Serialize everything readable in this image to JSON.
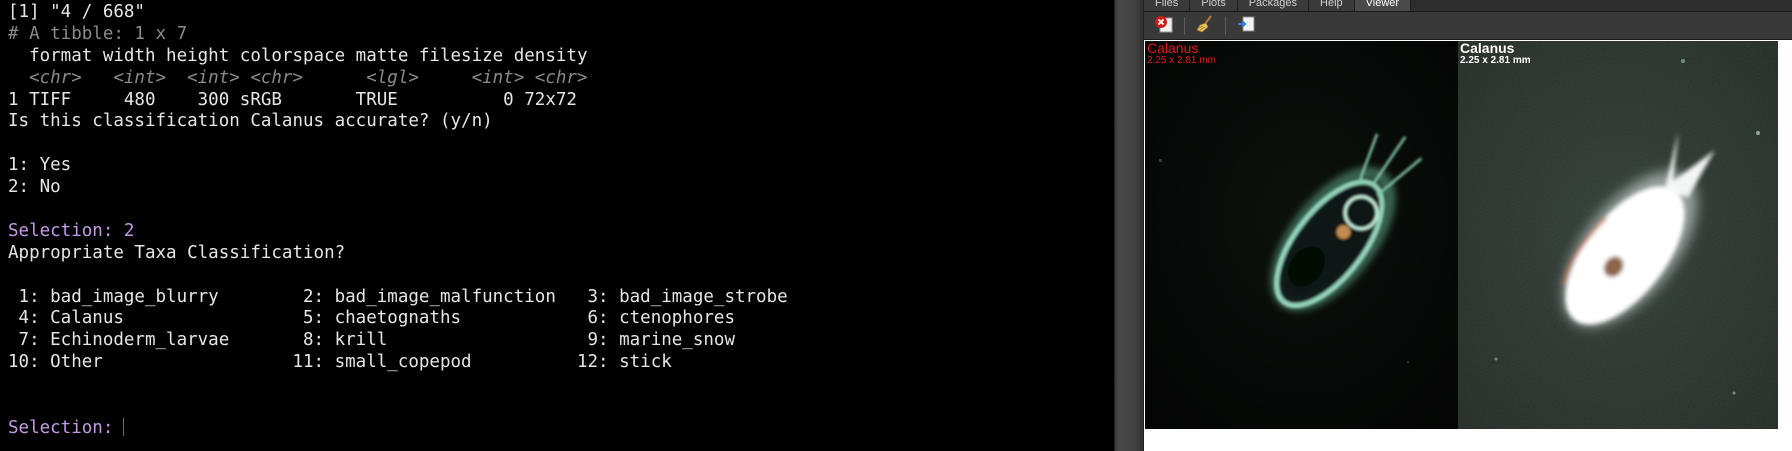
{
  "console": {
    "output_line": "[1] \"4 / 668\"",
    "tibble_header": "# A tibble: 1 x 7",
    "columns_header": "  format width height colorspace matte filesize density",
    "types_row": "  <chr>   <int>  <int> <chr>      <lgl>     <int> <chr>",
    "data_row": "1 TIFF     480    300 sRGB       TRUE          0 72x72",
    "question": "Is this classification Calanus accurate? (y/n)",
    "option_yes": "1: Yes",
    "option_no": "2: No",
    "selection_made": "Selection: 2",
    "taxa_question": "Appropriate Taxa Classification?",
    "taxa_rows": [
      " 1: bad_image_blurry        2: bad_image_malfunction   3: bad_image_strobe",
      " 4: Calanus                 5: chaetognaths            6: ctenophores",
      " 7: Echinoderm_larvae       8: krill                   9: marine_snow",
      "10: Other                  11: small_copepod          12: stick"
    ],
    "prompt_label": "Selection:"
  },
  "pane": {
    "tabs": [
      "Files",
      "Plots",
      "Packages",
      "Help",
      "Viewer"
    ],
    "active_tab": "Viewer",
    "toolbar_icons": [
      "remove-viewer-icon",
      "clear-all-broom-icon",
      "export-icon"
    ]
  },
  "viewer": {
    "left_image": {
      "title": "Calanus",
      "subtitle": "2.25 x 2.81 mm",
      "label_color": "#e01a1a"
    },
    "right_image": {
      "title": "Calanus",
      "subtitle": "2.25 x 2.81 mm",
      "label_color": "#ffffff"
    }
  },
  "colors": {
    "console_bg": "#000000",
    "console_text": "#e6e6e6",
    "selection_purple": "#c39be6",
    "muted_gray": "#8a8a8a"
  }
}
